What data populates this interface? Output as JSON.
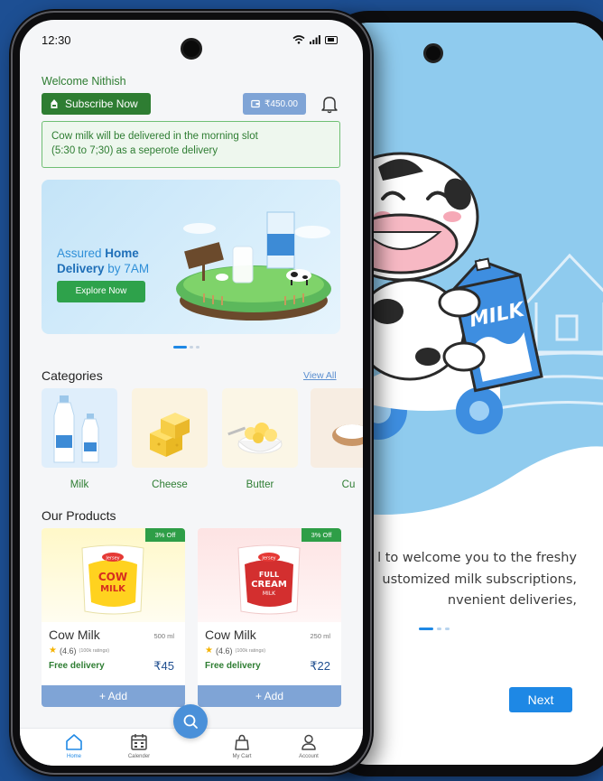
{
  "status_bar": {
    "time": "12:30"
  },
  "header": {
    "welcome": "Welcome Nithish",
    "subscribe_label": "Subscribe Now",
    "wallet_amount": "₹450.00"
  },
  "notice": {
    "line1": "Cow milk will be delivered in the morning slot",
    "line2": "(5:30 to 7;30) as a seperote delivery"
  },
  "banner": {
    "line1_a": "Assured ",
    "line1_b": "Home",
    "line2_a": "Delivery",
    "line2_b": " by 7AM",
    "cta": "Explore Now",
    "slides": 3,
    "active_slide": 0
  },
  "categories": {
    "title": "Categories",
    "view_all": "View All",
    "items": [
      {
        "label": "Milk"
      },
      {
        "label": "Cheese"
      },
      {
        "label": "Butter"
      },
      {
        "label": "Cu"
      }
    ]
  },
  "products": {
    "title": "Our Products",
    "items": [
      {
        "name": "Cow Milk",
        "qty": "500 ml",
        "offer": "3% Off",
        "rating": "(4.6)",
        "rating_count": "(100k ratings)",
        "delivery": "Free delivery",
        "price": "₹45",
        "add": "+ Add",
        "pack_brand": "Jersey",
        "pack_label_1": "COW",
        "pack_label_2": "MILK"
      },
      {
        "name": "Cow Milk",
        "qty": "250 ml",
        "offer": "3% Off",
        "rating": "(4.6)",
        "rating_count": "(100k ratings)",
        "delivery": "Free delivery",
        "price": "₹22",
        "add": "+ Add",
        "pack_brand": "Jersey",
        "pack_label_1": "FULL",
        "pack_label_2": "CREAM",
        "pack_label_3": "MILK"
      }
    ]
  },
  "bottom_nav": {
    "items": [
      {
        "label": "Home",
        "icon": "home-icon",
        "active": true
      },
      {
        "label": "Calender",
        "icon": "calendar-icon",
        "active": false
      },
      {
        "label": "My Cart",
        "icon": "cart-icon",
        "active": false
      },
      {
        "label": "Account",
        "icon": "account-icon",
        "active": false
      }
    ],
    "fab_icon": "search-icon"
  },
  "onboarding": {
    "illustration_label": "MILK",
    "lines": [
      "l to welcome you to the freshy",
      "ustomized milk subscriptions,",
      "nvenient deliveries,"
    ],
    "next_label": "Next"
  },
  "colors": {
    "background": "#1d4f93",
    "brand_green": "#2e7d32",
    "accent_blue": "#1e88e5",
    "wallet_blue": "#7fa4d6",
    "sky": "#8fcbee"
  }
}
